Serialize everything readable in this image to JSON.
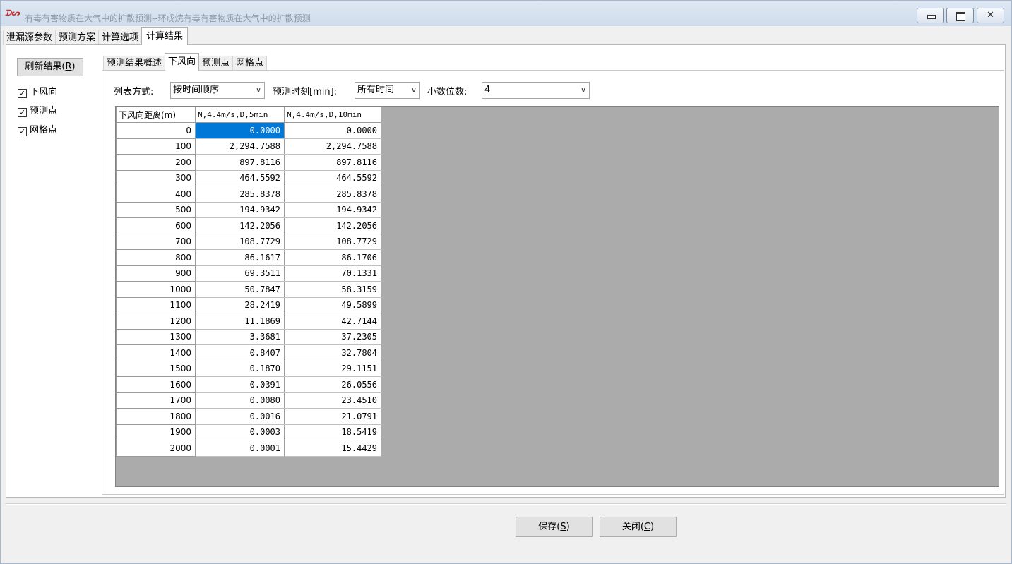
{
  "window": {
    "title": "有毒有害物质在大气中的扩散预测--环戊烷有毒有害物质在大气中的扩散预测"
  },
  "main_tabs": [
    {
      "label": "泄漏源参数",
      "active": false
    },
    {
      "label": "预测方案",
      "active": false
    },
    {
      "label": "计算选项",
      "active": false
    },
    {
      "label": "计算结果",
      "active": true
    }
  ],
  "left_panel": {
    "refresh_label": "刷新结果(",
    "refresh_key": "R",
    "refresh_suffix": ")",
    "checkboxes": [
      {
        "label": "下风向",
        "checked": true
      },
      {
        "label": "预测点",
        "checked": true
      },
      {
        "label": "网格点",
        "checked": true
      }
    ]
  },
  "sub_tabs": [
    {
      "label": "预测结果概述",
      "active": false
    },
    {
      "label": "下风向",
      "active": true
    },
    {
      "label": "预测点",
      "active": false
    },
    {
      "label": "网格点",
      "active": false
    }
  ],
  "options": {
    "list_mode_label": "列表方式:",
    "list_mode_value": "按时间顺序",
    "time_label": "预测时刻[min]:",
    "time_value": "所有时间",
    "decimals_label": "小数位数:",
    "decimals_value": "4"
  },
  "table": {
    "headers": [
      "下风向距离(m)",
      "N,4.4m/s,D,5min",
      "N,4.4m/s,D,10min"
    ],
    "rows": [
      [
        "0",
        "0.0000",
        "0.0000"
      ],
      [
        "100",
        "2,294.7588",
        "2,294.7588"
      ],
      [
        "200",
        "897.8116",
        "897.8116"
      ],
      [
        "300",
        "464.5592",
        "464.5592"
      ],
      [
        "400",
        "285.8378",
        "285.8378"
      ],
      [
        "500",
        "194.9342",
        "194.9342"
      ],
      [
        "600",
        "142.2056",
        "142.2056"
      ],
      [
        "700",
        "108.7729",
        "108.7729"
      ],
      [
        "800",
        "86.1617",
        "86.1706"
      ],
      [
        "900",
        "69.3511",
        "70.1331"
      ],
      [
        "1000",
        "50.7847",
        "58.3159"
      ],
      [
        "1100",
        "28.2419",
        "49.5899"
      ],
      [
        "1200",
        "11.1869",
        "42.7144"
      ],
      [
        "1300",
        "3.3681",
        "37.2305"
      ],
      [
        "1400",
        "0.8407",
        "32.7804"
      ],
      [
        "1500",
        "0.1870",
        "29.1151"
      ],
      [
        "1600",
        "0.0391",
        "26.0556"
      ],
      [
        "1700",
        "0.0080",
        "23.4510"
      ],
      [
        "1800",
        "0.0016",
        "21.0791"
      ],
      [
        "1900",
        "0.0003",
        "18.5419"
      ],
      [
        "2000",
        "0.0001",
        "15.4429"
      ]
    ]
  },
  "footer": {
    "save_label": "保存(",
    "save_key": "S",
    "close_label": "关闭(",
    "close_key": "C",
    "suffix": ")"
  },
  "colors": {
    "selection": "#0078d7",
    "grid_background": "#ababab"
  },
  "icons": {
    "app": "app-logo-icon",
    "minimize": "minimize-icon",
    "maximize": "maximize-icon",
    "close": "close-icon",
    "dropdown": "chevron-down-icon",
    "checkbox": "checkmark-icon"
  }
}
